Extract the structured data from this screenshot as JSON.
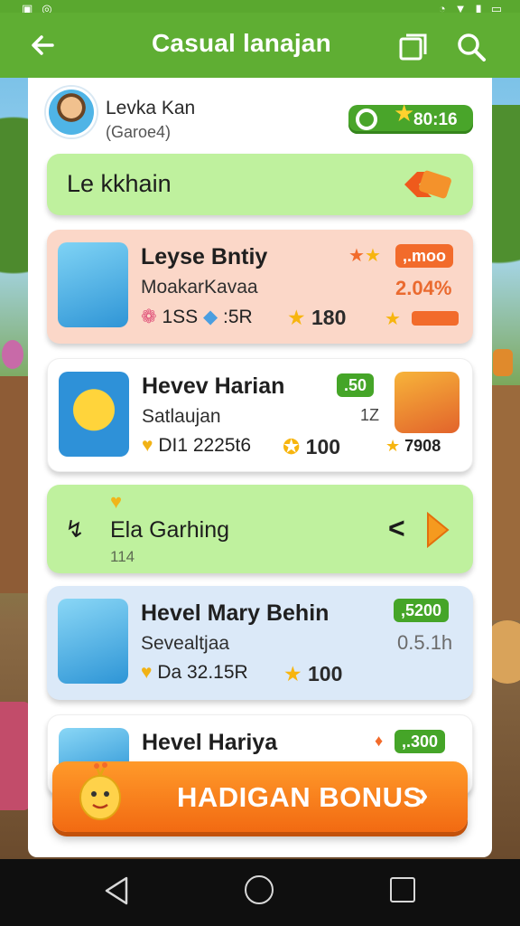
{
  "statusbar": {
    "left_icons": [
      "sim-icon",
      "sync-icon"
    ],
    "right_icons": [
      "alarm-icon",
      "wifi-icon",
      "signal-icon",
      "battery-icon"
    ]
  },
  "appbar": {
    "title": "Casual lanajan",
    "icons": [
      "back-arrow-icon",
      "copy-icon",
      "search-icon"
    ]
  },
  "profile": {
    "name": "Levka Kan",
    "subtitle": "(Garoe4)",
    "score": "80:16"
  },
  "banner": {
    "label": "Le kkhain"
  },
  "cards": [
    {
      "title": "Leyse Bntiy",
      "subtitle": "MoakarKavaa",
      "stat_a": "1SS",
      "stat_b": ":5R",
      "reward": "180",
      "badge": ",.moo",
      "right_value": "2.04%",
      "colors": {
        "bg": "#fbd7c8",
        "badge": "#f26b2b"
      }
    },
    {
      "title": "Hevev Harian",
      "subtitle": "Satlaujan",
      "stat_a": "DI1 2225t6",
      "reward": "100",
      "badge": ".50",
      "right_value": "1Z",
      "side_value": "7908",
      "colors": {
        "bg": "#ffffff",
        "badge": "#45a528"
      }
    },
    {
      "title": "Hevel Mary Behin",
      "subtitle": "Sevealtjaa",
      "stat_a": "Da 32.15R",
      "reward": "100",
      "badge": ",5200",
      "right_value": "0.5.1h",
      "colors": {
        "bg": "#dbe9f8",
        "badge": "#45a528"
      }
    },
    {
      "title": "Hevel Hariya",
      "badge": ",.300",
      "colors": {
        "bg": "#ffffff",
        "badge": "#45a528"
      }
    }
  ],
  "section": {
    "label": "Ela Garhing",
    "sub": "114"
  },
  "cta": {
    "label": "HADIGAN BONUS"
  },
  "navbar": {
    "icons": [
      "nav-back-icon",
      "nav-home-icon",
      "nav-recents-icon"
    ]
  }
}
